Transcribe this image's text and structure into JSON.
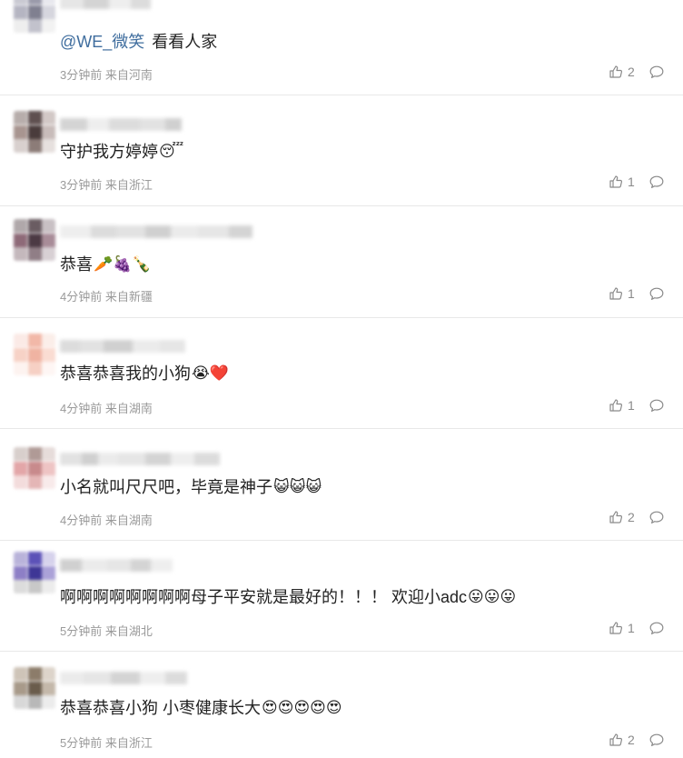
{
  "comments": [
    {
      "mention": "@WE_微笑",
      "text": "看看人家",
      "emojis": "",
      "meta": "3分钟前 来自河南",
      "likes": "2",
      "avatar_colors": [
        "#c9c9d2",
        "#9a9aaa",
        "#e8e8ee",
        "#b5b5c2",
        "#808090",
        "#d6d6de",
        "#eeeeee",
        "#c2c2cc",
        "#f2f2f2"
      ]
    },
    {
      "mention": "",
      "text": "守护我方婷婷",
      "emojis": "😴",
      "meta": "3分钟前 来自浙江",
      "likes": "1",
      "avatar_colors": [
        "#b7adab",
        "#5f5050",
        "#d2c8c6",
        "#a89590",
        "#4a3c3c",
        "#c8bcba",
        "#d8d0ce",
        "#8c7c78",
        "#e6e0de"
      ]
    },
    {
      "mention": "",
      "text": "恭喜",
      "emojis": "🥕🍇🍾",
      "meta": "4分钟前 来自新疆",
      "likes": "1",
      "avatar_colors": [
        "#b0a8aa",
        "#6a5c62",
        "#c8c0c4",
        "#8e6a78",
        "#4c3a44",
        "#a88c98",
        "#c4b8bc",
        "#907e86",
        "#d8d0d4"
      ]
    },
    {
      "mention": "",
      "text": "恭喜恭喜我的小狗",
      "emojis": "😭❤️",
      "meta": "4分钟前 来自湖南",
      "likes": "1",
      "avatar_colors": [
        "#fbeae6",
        "#f2b8a8",
        "#fbeee9",
        "#f7d2c6",
        "#f0b3a2",
        "#fadcd2",
        "#fdf3f0",
        "#f6d0c4",
        "#fef6f4"
      ]
    },
    {
      "mention": "",
      "text": "小名就叫尺尺吧，毕竟是神子",
      "emojis": "😺😺😺",
      "meta": "4分钟前 来自湖南",
      "likes": "2",
      "avatar_colors": [
        "#d8cfcc",
        "#b09a96",
        "#e6dcda",
        "#e3a6a8",
        "#c88a8c",
        "#eec4c4",
        "#f3dcdc",
        "#e4b6b6",
        "#f8eaea"
      ]
    },
    {
      "mention": "",
      "text": "啊啊啊啊啊啊啊啊母子平安就是最好的！！！ 欢迎小adc",
      "emojis": "😛😛😛",
      "meta": "5分钟前 来自湖北",
      "likes": "1",
      "avatar_colors": [
        "#b9b3da",
        "#5c52b8",
        "#d6d2ec",
        "#8d7fc6",
        "#3e3696",
        "#aba2d8",
        "#dcdcdc",
        "#c8c8c8",
        "#ececec"
      ]
    },
    {
      "mention": "",
      "text": "恭喜恭喜小狗 小枣健康长大",
      "emojis": "😍😍😍😍😍",
      "meta": "5分钟前 来自浙江",
      "likes": "2",
      "avatar_colors": [
        "#cec4b8",
        "#8c7c6a",
        "#ddd4ca",
        "#a89a8a",
        "#6a5c4c",
        "#c4b8aa",
        "#d8d8d8",
        "#b8b8b8",
        "#ececec"
      ]
    }
  ],
  "icons": {
    "like": "thumbs-up-icon",
    "reply": "comment-bubble-icon"
  },
  "colors": {
    "text": "#222222",
    "mention": "#3f6d9e",
    "meta": "#9a9a9a",
    "icon": "#8a8a8a",
    "divider": "#e8e8e8"
  }
}
